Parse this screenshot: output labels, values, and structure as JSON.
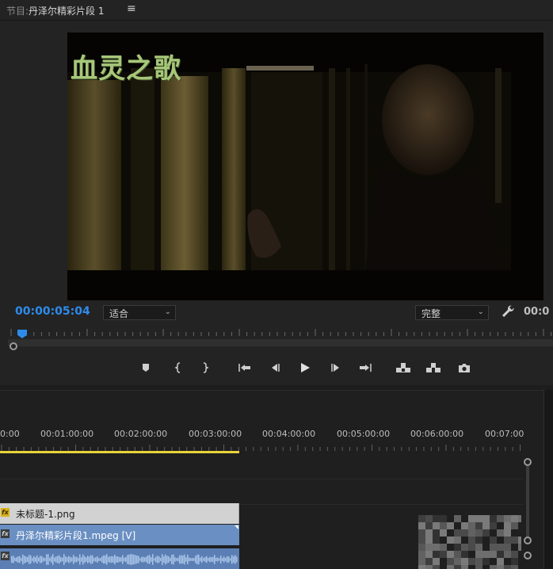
{
  "program_monitor": {
    "tab_prefix": "节目:",
    "tab_title": "丹泽尔精彩片段 1",
    "menu_glyph": "≡",
    "video_title": "血灵之歌",
    "current_timecode": "00:00:05:04",
    "zoom": {
      "selected": "适合"
    },
    "quality": {
      "selected": "完整"
    },
    "duration_timecode_partial": "00:0",
    "transport_icons": [
      "add-marker-icon",
      "mark-in-icon",
      "mark-out-icon",
      "go-to-in-icon",
      "step-back-icon",
      "play-icon",
      "step-forward-icon",
      "go-to-out-icon",
      "lift-icon",
      "extract-icon",
      "export-frame-icon"
    ],
    "accent_color": "#2d8ceb"
  },
  "timeline": {
    "ruler_labels": [
      "0:00",
      "00:01:00:00",
      "00:02:00:00",
      "00:03:00:00",
      "00:04:00:00",
      "00:05:00:00",
      "00:06:00:00",
      "00:07:00"
    ],
    "work_area_color": "#e8d33a",
    "clips": {
      "graphic": {
        "label": "未标题-1.png",
        "fx": "fx"
      },
      "video": {
        "label": "丹泽尔精彩片段1.mpeg [V]",
        "fx": "fx"
      },
      "audio": {
        "fx": "fx"
      }
    }
  }
}
